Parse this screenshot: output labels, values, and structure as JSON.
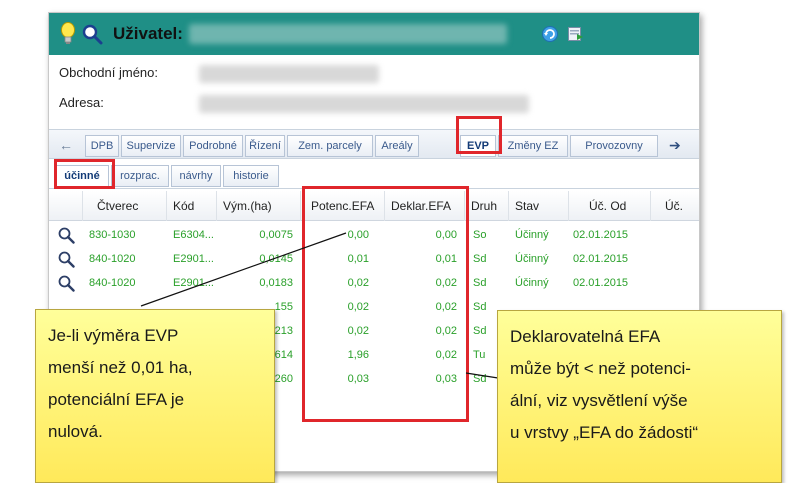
{
  "header": {
    "title_label": "Uživatel:",
    "bulb_icon": "lightbulb-icon",
    "search_icon": "magnifier-icon",
    "refresh_icon": "refresh-icon",
    "export_icon": "export-icon"
  },
  "info": {
    "business_name_label": "Obchodní jméno:",
    "address_label": "Adresa:"
  },
  "tabs": {
    "prev_arrow": "←",
    "next_arrow": "➔",
    "items": [
      "DPB",
      "Supervize",
      "Podrobné",
      "Řízení",
      "Zem. parcely",
      "Areály",
      "EVP",
      "Změny EZ",
      "Provozovny"
    ],
    "active": "EVP"
  },
  "subtabs": {
    "items": [
      "účinné",
      "rozprac.",
      "návrhy",
      "historie"
    ],
    "active": "účinné"
  },
  "grid": {
    "columns": [
      "Čtverec",
      "Kód",
      "Vým.(ha)",
      "Potenc.EFA",
      "Deklar.EFA",
      "Druh",
      "Stav",
      "Úč. Od",
      "Úč. "
    ],
    "rows": [
      [
        "830-1030",
        "E6304...",
        "0,0075",
        "0,00",
        "0,00",
        "So",
        "Účinný",
        "02.01.2015"
      ],
      [
        "840-1020",
        "E2901...",
        "0,0145",
        "0,01",
        "0,01",
        "Sd",
        "Účinný",
        "02.01.2015"
      ],
      [
        "840-1020",
        "E2901...",
        "0,0183",
        "0,02",
        "0,02",
        "Sd",
        "Účinný",
        "02.01.2015"
      ],
      [
        "",
        "",
        "155",
        "0,02",
        "0,02",
        "Sd",
        "",
        ""
      ],
      [
        "",
        "",
        "213",
        "0,02",
        "0,02",
        "Sd",
        "",
        ""
      ],
      [
        "",
        "",
        "614",
        "1,96",
        "0,02",
        "Tu",
        "",
        ""
      ],
      [
        "",
        "",
        "260",
        "0,03",
        "0,03",
        "Sd",
        "",
        ""
      ]
    ],
    "text_color": "#2aa02a"
  },
  "callouts": {
    "left": [
      "Je-li výměra EVP",
      "menší než 0,01 ha,",
      "potenciální EFA je",
      "nulová."
    ],
    "right": [
      "Deklarovatelná EFA",
      "může být < než potenci-",
      "ální, viz vysvětlení výše",
      "u vrstvy „EFA do žádosti“"
    ]
  },
  "colors": {
    "header_teal": "#1f8f86",
    "highlight_red": "#e0262b",
    "callout_yellow": "#ffef6a"
  }
}
